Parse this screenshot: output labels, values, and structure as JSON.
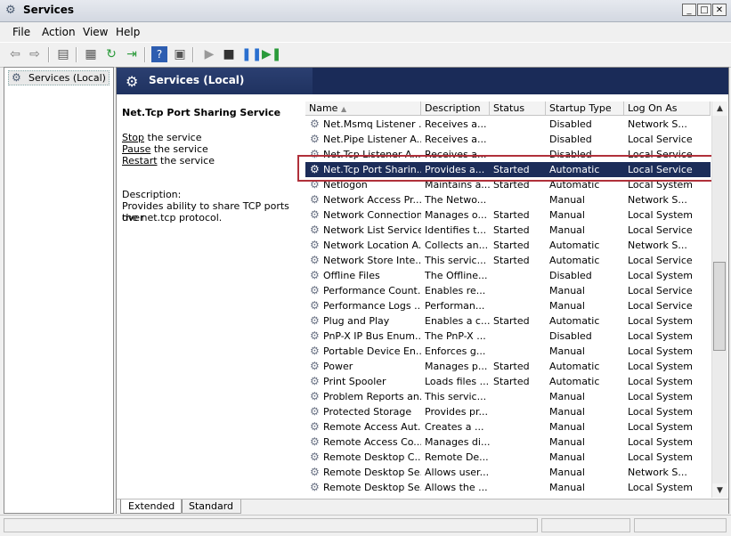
{
  "window": {
    "title": "Services",
    "icon": "gear-icon"
  },
  "menu": [
    "File",
    "Action",
    "View",
    "Help"
  ],
  "tree": {
    "root_label": "Services (Local)"
  },
  "header": {
    "title": "Services (Local)"
  },
  "details": {
    "service_name": "Net.Tcp Port Sharing Service",
    "stop_link": "Stop",
    "stop_suffix": " the service",
    "pause_link": "Pause",
    "pause_suffix": " the service",
    "restart_link": "Restart",
    "restart_suffix": " the service",
    "description_label": "Description:",
    "description_line1": "Provides ability to share TCP ports over",
    "description_line2": "the net.tcp protocol."
  },
  "columns": [
    "Name",
    "Description",
    "Status",
    "Startup Type",
    "Log On As"
  ],
  "rows": [
    [
      "Net.Msmq Listener ...",
      "Receives a...",
      "",
      "Disabled",
      "Network S..."
    ],
    [
      "Net.Pipe Listener A...",
      "Receives a...",
      "",
      "Disabled",
      "Local Service"
    ],
    [
      "Net.Tcp Listener A...",
      "Receives a...",
      "",
      "Disabled",
      "Local Service"
    ],
    [
      "Net.Tcp Port Sharin...",
      "Provides a...",
      "Started",
      "Automatic",
      "Local Service"
    ],
    [
      "Netlogon",
      "Maintains a...",
      "Started",
      "Automatic",
      "Local System"
    ],
    [
      "Network Access Pr...",
      "The Netwo...",
      "",
      "Manual",
      "Network S..."
    ],
    [
      "Network Connections",
      "Manages o...",
      "Started",
      "Manual",
      "Local System"
    ],
    [
      "Network List Service",
      "Identifies t...",
      "Started",
      "Manual",
      "Local Service"
    ],
    [
      "Network Location A...",
      "Collects an...",
      "Started",
      "Automatic",
      "Network S..."
    ],
    [
      "Network Store Inte...",
      "This servic...",
      "Started",
      "Automatic",
      "Local Service"
    ],
    [
      "Offline Files",
      "The Offline...",
      "",
      "Disabled",
      "Local System"
    ],
    [
      "Performance Count...",
      "Enables re...",
      "",
      "Manual",
      "Local Service"
    ],
    [
      "Performance Logs ...",
      "Performan...",
      "",
      "Manual",
      "Local Service"
    ],
    [
      "Plug and Play",
      "Enables a c...",
      "Started",
      "Automatic",
      "Local System"
    ],
    [
      "PnP-X IP Bus Enum...",
      "The PnP-X ...",
      "",
      "Disabled",
      "Local System"
    ],
    [
      "Portable Device En...",
      "Enforces g...",
      "",
      "Manual",
      "Local System"
    ],
    [
      "Power",
      "Manages p...",
      "Started",
      "Automatic",
      "Local System"
    ],
    [
      "Print Spooler",
      "Loads files ...",
      "Started",
      "Automatic",
      "Local System"
    ],
    [
      "Problem Reports an...",
      "This servic...",
      "",
      "Manual",
      "Local System"
    ],
    [
      "Protected Storage",
      "Provides pr...",
      "",
      "Manual",
      "Local System"
    ],
    [
      "Remote Access Aut...",
      "Creates a ...",
      "",
      "Manual",
      "Local System"
    ],
    [
      "Remote Access Co...",
      "Manages di...",
      "",
      "Manual",
      "Local System"
    ],
    [
      "Remote Desktop C...",
      "Remote De...",
      "",
      "Manual",
      "Local System"
    ],
    [
      "Remote Desktop Se...",
      "Allows user...",
      "",
      "Manual",
      "Network S..."
    ],
    [
      "Remote Desktop Se...",
      "Allows the ...",
      "",
      "Manual",
      "Local System"
    ]
  ],
  "selected_row": 3,
  "tabs": [
    "Extended",
    "Standard"
  ],
  "colors": {
    "header_bg": "#1f3260",
    "selection_bg": "#1c2d59",
    "highlight_border": "#b0303a"
  }
}
